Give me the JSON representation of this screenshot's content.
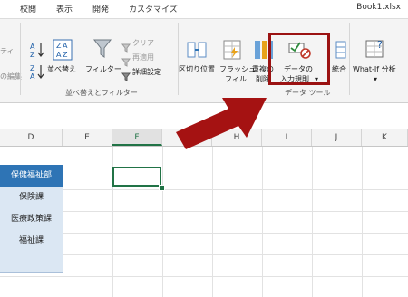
{
  "tabs": [
    "校閲",
    "表示",
    "開発",
    "カスタマイズ"
  ],
  "file_name": "Book1.xlsx",
  "ribbon": {
    "left_partial": [
      "ティ",
      "の編集"
    ],
    "sort_filter_group": {
      "sort_asc_label": "A↓Z",
      "sort_desc_label": "Z↓A",
      "sort_label": "並べ替え",
      "filter_label": "フィルター",
      "clear_label": "クリア",
      "reapply_label": "再適用",
      "advanced_label": "詳細設定",
      "group_label": "並べ替えとフィルター"
    },
    "data_tools_group": {
      "text_to_columns_label": "区切り位置",
      "flash_fill_line1": "フラッシュ",
      "flash_fill_line2": "フィル",
      "remove_dup_line1": "重複の",
      "remove_dup_line2": "削除",
      "validation_line1": "データの",
      "validation_line2": "入力規則",
      "consolidate_label": "統合",
      "group_label": "データ ツール"
    },
    "whatif_label": "What-If 分析"
  },
  "columns": [
    "D",
    "E",
    "F",
    "G",
    "H",
    "I",
    "J",
    "K"
  ],
  "active_column": "F",
  "departments": [
    "保健福祉部",
    "保険課",
    "医療政策課",
    "福祉課"
  ],
  "colors": {
    "accent": "#217346",
    "highlight": "#9b1212",
    "dept_header": "#2e74b5",
    "dept_fill": "#dbe7f3"
  }
}
